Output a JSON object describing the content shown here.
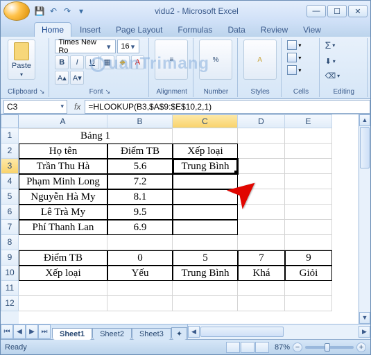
{
  "window": {
    "title": "vidu2 - Microsoft Excel"
  },
  "qat": {
    "save_tip": "Save",
    "undo_tip": "Undo",
    "redo_tip": "Redo"
  },
  "tabs": [
    "Home",
    "Insert",
    "Page Layout",
    "Formulas",
    "Data",
    "Review",
    "View"
  ],
  "ribbon": {
    "clipboard": {
      "paste": "Paste",
      "label": "Clipboard"
    },
    "font": {
      "name": "Times New Ro",
      "size": "16",
      "label": "Font"
    },
    "alignment": {
      "label": "Alignment"
    },
    "number": {
      "label": "Number"
    },
    "styles": {
      "label": "Styles"
    },
    "cells": {
      "label": "Cells"
    },
    "editing": {
      "label": "Editing"
    }
  },
  "namebox": "C3",
  "fx": "fx",
  "formula": "=HLOOKUP(B3,$A$9:$E$10,2,1)",
  "colWidths": {
    "A": 128,
    "B": 94,
    "C": 94,
    "D": 68,
    "E": 68
  },
  "columns": [
    "A",
    "B",
    "C",
    "D",
    "E"
  ],
  "rows": [
    "1",
    "2",
    "3",
    "4",
    "5",
    "6",
    "7",
    "8",
    "9",
    "10",
    "11",
    "12"
  ],
  "cells": {
    "r1": {
      "A": "Bảng 1"
    },
    "r2": {
      "A": "Họ tên",
      "B": "Điểm TB",
      "C": "Xếp loại"
    },
    "r3": {
      "A": "Trần Thu Hà",
      "B": "5.6",
      "C": "Trung Bình"
    },
    "r4": {
      "A": "Phạm Minh Long",
      "B": "7.2"
    },
    "r5": {
      "A": "Nguyễn Hà My",
      "B": "8.1"
    },
    "r6": {
      "A": "Lê Trà My",
      "B": "9.5"
    },
    "r7": {
      "A": "Phí Thanh Lan",
      "B": "6.9"
    },
    "r9": {
      "A": "Điểm TB",
      "B": "0",
      "C": "5",
      "D": "7",
      "E": "9"
    },
    "r10": {
      "A": "Xếp loại",
      "B": "Yếu",
      "C": "Trung Bình",
      "D": "Khá",
      "E": "Giỏi"
    }
  },
  "sheets": [
    "Sheet1",
    "Sheet2",
    "Sheet3"
  ],
  "status": {
    "ready": "Ready",
    "zoom": "87%"
  },
  "watermark": "uanTrimang"
}
